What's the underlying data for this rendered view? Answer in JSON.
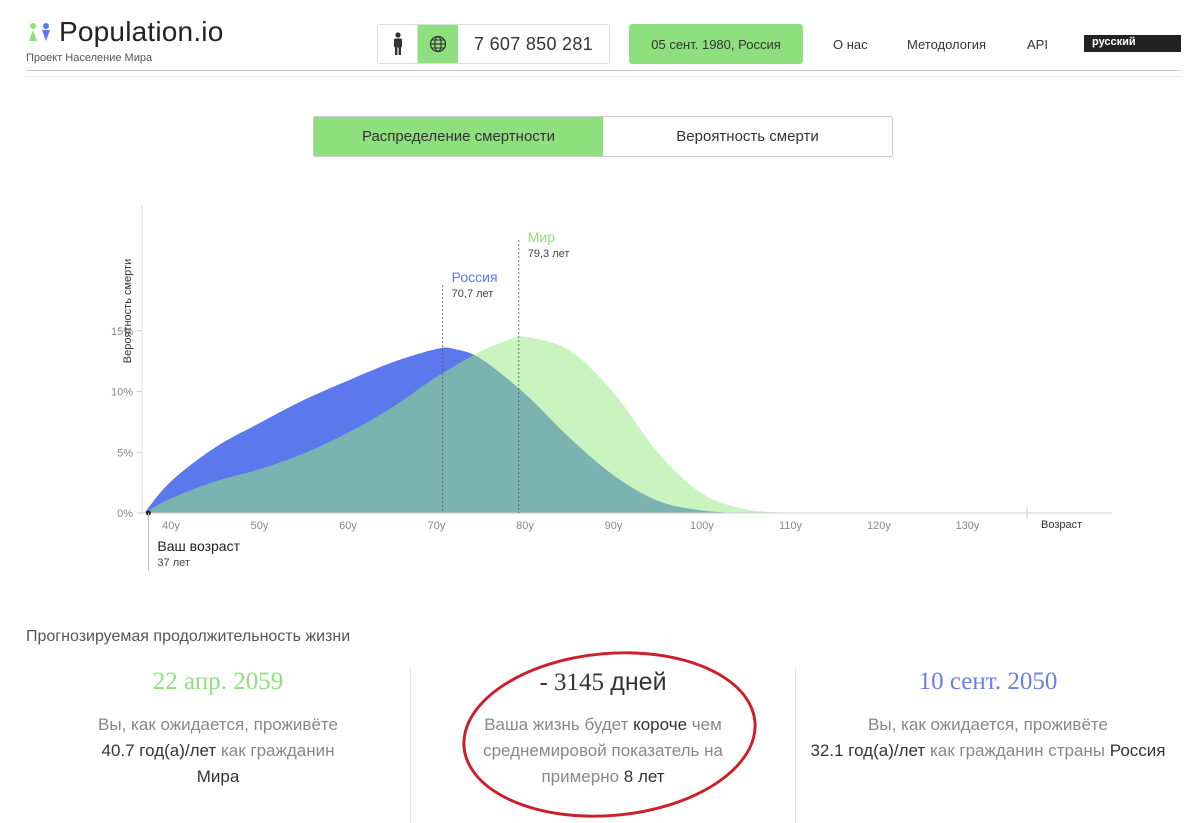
{
  "header": {
    "logo_text": "Population.io",
    "logo_sub": "Проект Население Мира",
    "counter_value": "7 607 850 281",
    "birth_button": "05 сент. 1980, Россия",
    "nav": [
      "О нас",
      "Методология",
      "API"
    ],
    "language": "русский"
  },
  "tabs": [
    {
      "label": "Распределение смертности",
      "active": true
    },
    {
      "label": "Вероятность смерти",
      "active": false
    }
  ],
  "colors": {
    "green": "#8ee07f",
    "blue": "#5b78ec",
    "overlap": "#7bb3b0",
    "world_fill": "#c9f4c0",
    "annotation_red": "#cc1f2a"
  },
  "chart_data": {
    "type": "area",
    "ylabel": "Вероятность смерти",
    "xlabel": "Возраст",
    "x_ticks": [
      "40y",
      "50y",
      "60y",
      "70y",
      "80y",
      "90y",
      "100y",
      "110y",
      "120y",
      "130y"
    ],
    "y_ticks": [
      "0%",
      "5%",
      "10%",
      "15%"
    ],
    "xlim": [
      37,
      130
    ],
    "ylim": [
      0,
      15
    ],
    "series": [
      {
        "name": "Россия",
        "mean_label": "70,7 лет",
        "mean": 70.7,
        "x": [
          37,
          40,
          45,
          50,
          55,
          60,
          65,
          70,
          72,
          75,
          80,
          85,
          90,
          95,
          100,
          105,
          110
        ],
        "values": [
          0,
          2.6,
          5.4,
          7.4,
          9.3,
          10.9,
          12.4,
          13.5,
          13.5,
          12.7,
          9.8,
          6.2,
          3.1,
          1.0,
          0.2,
          0,
          0
        ]
      },
      {
        "name": "Мир",
        "mean_label": "79,3 лет",
        "mean": 79.3,
        "x": [
          37,
          40,
          45,
          50,
          55,
          60,
          65,
          70,
          75,
          78,
          80,
          85,
          90,
          95,
          100,
          105,
          110
        ],
        "values": [
          0,
          1.2,
          2.6,
          3.6,
          4.9,
          6.6,
          8.7,
          11.2,
          13.3,
          14.2,
          14.5,
          13.4,
          9.9,
          5.0,
          1.6,
          0.3,
          0
        ]
      }
    ],
    "your_age": {
      "label": "Ваш возраст",
      "value_label": "37 лет",
      "age": 37
    }
  },
  "stats": {
    "title": "Прогнозируемая продолжительность жизни",
    "world": {
      "date": "22 апр. 2059",
      "line1": "Вы, как ожидается, проживёте",
      "years": "40.7 год(а)/лет",
      "line2": "как гражданин",
      "entity": "Мира"
    },
    "diff": {
      "value": "- 3145",
      "unit": "дней",
      "t1": "Ваша жизнь будет",
      "shorter": "короче",
      "t2": "чем среднемировой показатель на примерно",
      "years": "8 лет"
    },
    "country": {
      "date": "10 сент. 2050",
      "line1": "Вы, как ожидается, проживёте",
      "years": "32.1 год(а)/лет",
      "line2": "как гражданин страны",
      "entity": "Россия"
    }
  }
}
